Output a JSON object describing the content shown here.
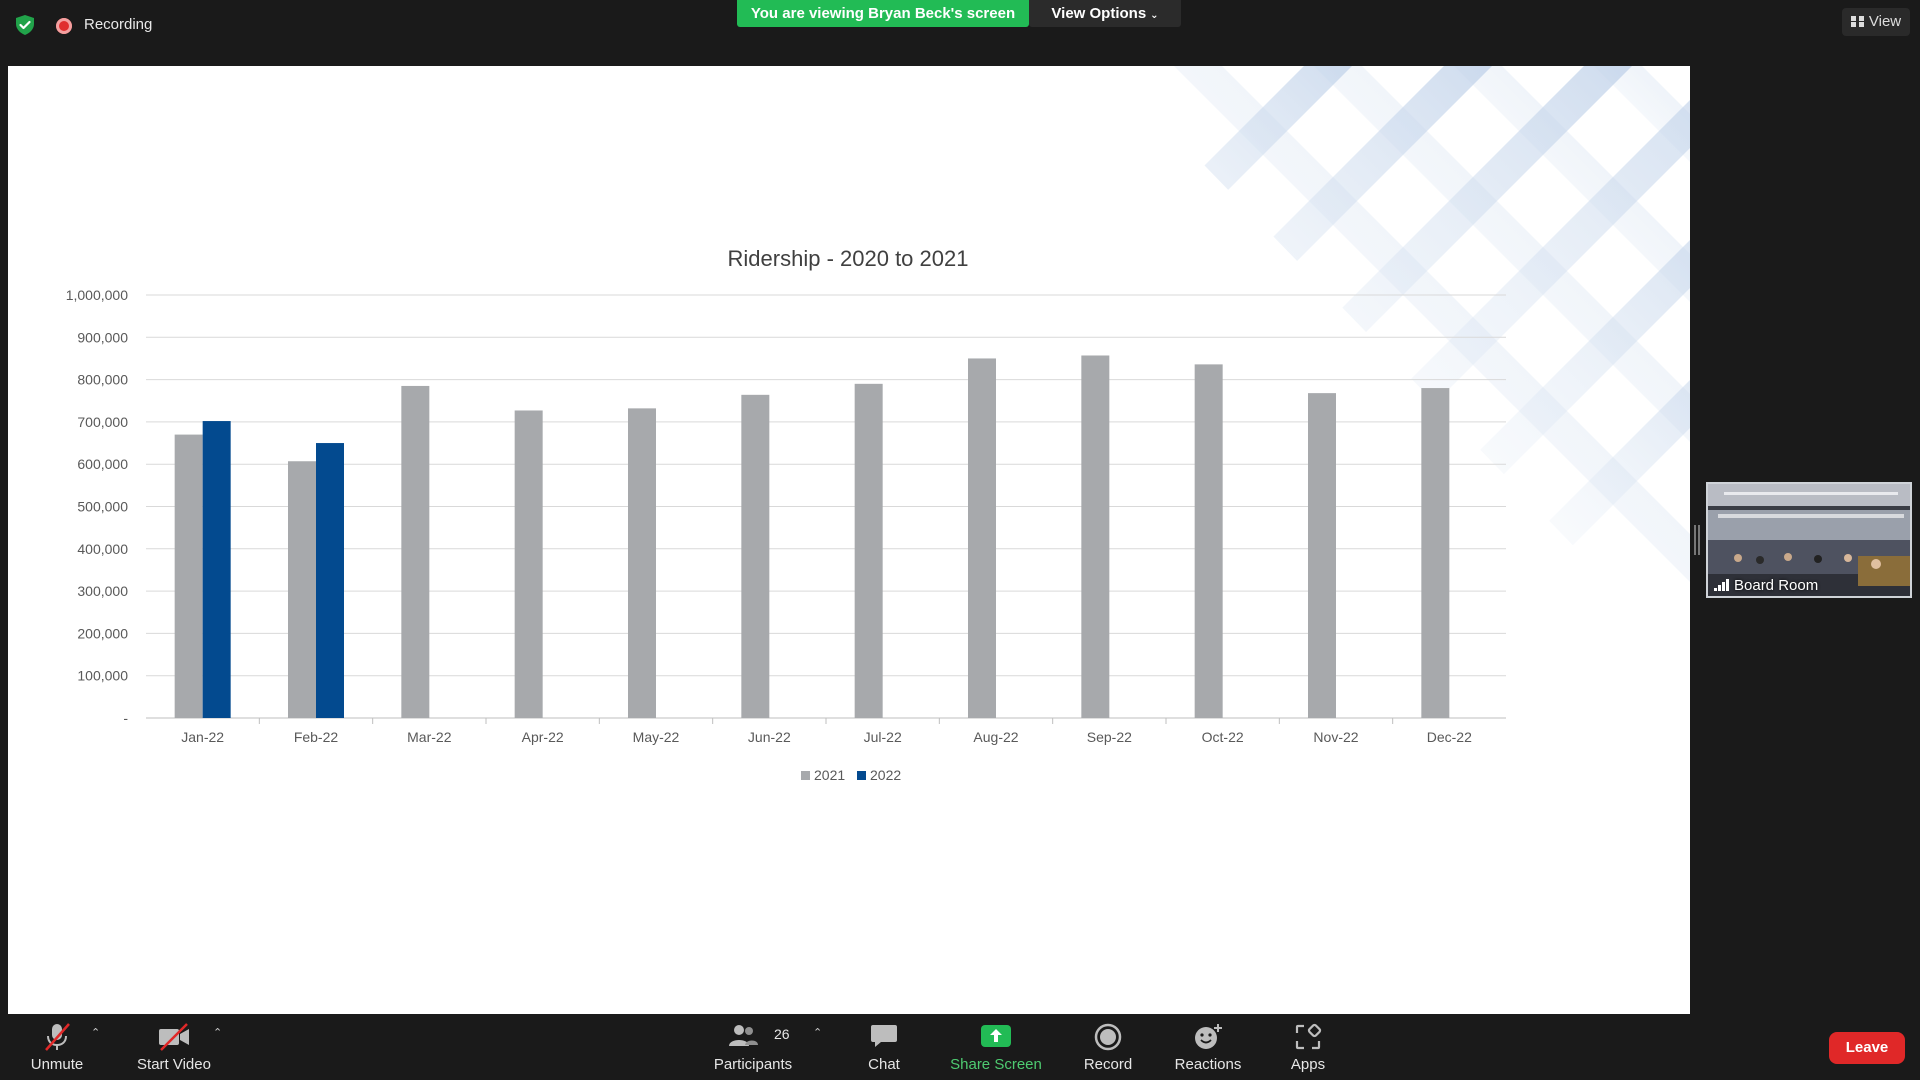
{
  "topbar": {
    "recording_label": "Recording",
    "banner_text": "You are viewing Bryan Beck's screen",
    "view_options_label": "View Options",
    "view_label": "View"
  },
  "colors": {
    "banner_green": "#22bb55",
    "leave_red": "#e02828",
    "series_2021": "#a7a9ac",
    "series_2022": "#034a8f"
  },
  "chart_data": {
    "type": "bar",
    "title": "Ridership - 2020 to 2021",
    "categories": [
      "Jan-22",
      "Feb-22",
      "Mar-22",
      "Apr-22",
      "May-22",
      "Jun-22",
      "Jul-22",
      "Aug-22",
      "Sep-22",
      "Oct-22",
      "Nov-22",
      "Dec-22"
    ],
    "series": [
      {
        "name": "2021",
        "color": "#a7a9ac",
        "values": [
          670000,
          607000,
          785000,
          727000,
          732000,
          764000,
          790000,
          850000,
          857000,
          836000,
          768000,
          780000
        ]
      },
      {
        "name": "2022",
        "color": "#034a8f",
        "values": [
          702000,
          650000,
          null,
          null,
          null,
          null,
          null,
          null,
          null,
          null,
          null,
          null
        ]
      }
    ],
    "ylim": [
      0,
      1000000
    ],
    "yticks": [
      0,
      100000,
      200000,
      300000,
      400000,
      500000,
      600000,
      700000,
      800000,
      900000,
      1000000
    ],
    "ytick_labels": [
      "-",
      "100,000",
      "200,000",
      "300,000",
      "400,000",
      "500,000",
      "600,000",
      "700,000",
      "800,000",
      "900,000",
      "1,000,000"
    ],
    "grid": true,
    "legend": "bottom"
  },
  "participant_tile": {
    "name": "Board Room"
  },
  "toolbar": {
    "unmute": "Unmute",
    "start_video": "Start Video",
    "participants": "Participants",
    "participant_count": "26",
    "chat": "Chat",
    "share_screen": "Share Screen",
    "record": "Record",
    "reactions": "Reactions",
    "apps": "Apps",
    "leave": "Leave"
  }
}
